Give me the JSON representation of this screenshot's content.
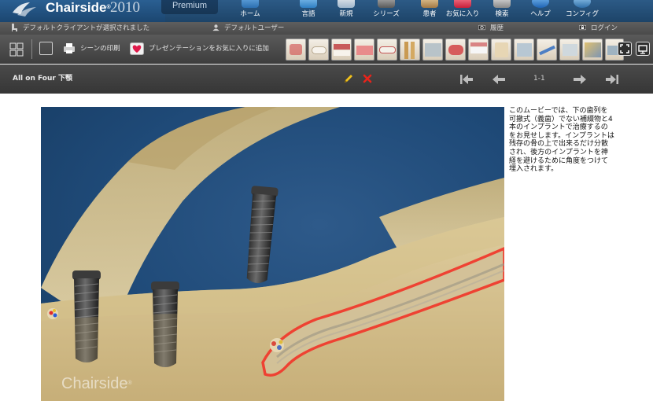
{
  "app": {
    "brand": "Chairside",
    "trademark": "®",
    "year": "2010",
    "edition": "Premium"
  },
  "nav": {
    "items": [
      {
        "label": "ホーム",
        "icon": "home-icon"
      },
      {
        "label": "言語",
        "icon": "language-icon"
      },
      {
        "label": "新規",
        "icon": "new-icon"
      },
      {
        "label": "シリーズ",
        "icon": "series-icon"
      },
      {
        "label": "患者",
        "icon": "patient-icon"
      },
      {
        "label": "お気に入り",
        "icon": "favorites-icon"
      },
      {
        "label": "検索",
        "icon": "search-icon"
      },
      {
        "label": "ヘルプ",
        "icon": "help-icon"
      },
      {
        "label": "コンフィグ",
        "icon": "config-icon"
      }
    ]
  },
  "status": {
    "client": "デフォルトクライアントが選択されました",
    "user": "デフォルトユーザー",
    "history": "履歴",
    "login": "ログイン"
  },
  "toolbar": {
    "print_scene": "シーンの印刷",
    "add_favorite": "プレゼンテーションをお気に入りに追加",
    "thumbnail_count": 15
  },
  "scene": {
    "title": "All on Four 下顎",
    "page": "1-1"
  },
  "content": {
    "watermark": "Chairside",
    "watermark_mark": "®",
    "description": "このムービーでは、下の歯列を可撤式（義歯）でない補綴物と4本のインプラントで治療するのをお見せします。インプラントは残存の骨の上で出来るだけ分散され、後方のインプラントを神経を避けるために角度をつけて埋入されます。"
  },
  "colors": {
    "header": "#1d4468",
    "toolbar": "#4a4a4a",
    "scene_bg": "#1f4a78",
    "bone": "#d9c79a",
    "nerve_outline": "#ff1a1a",
    "edit_pencil": "#f2c21b",
    "delete_x": "#e8241b"
  }
}
